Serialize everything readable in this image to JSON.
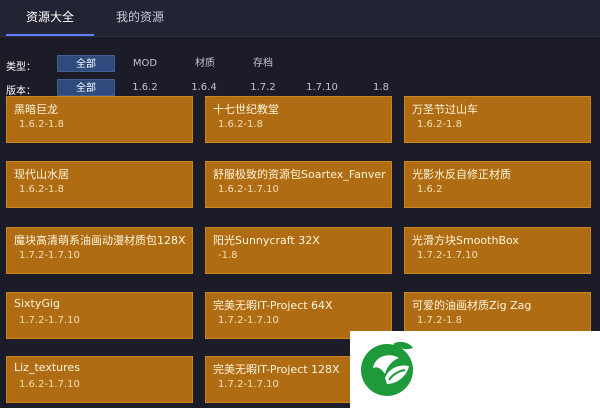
{
  "tabs": [
    {
      "label": "资源大全",
      "active": true
    },
    {
      "label": "我的资源",
      "active": false
    }
  ],
  "filters": {
    "type": {
      "label": "类型：",
      "options": [
        "全部",
        "MOD",
        "材质",
        "存档"
      ],
      "selected": "全部"
    },
    "version": {
      "label": "版本：",
      "options": [
        "全部",
        "1.6.2",
        "1.6.4",
        "1.7.2",
        "1.7.10",
        "1.8"
      ],
      "selected": "全部"
    }
  },
  "resources": [
    {
      "title": "黑暗巨龙",
      "versions": "1.6.2-1.8"
    },
    {
      "title": "十七世纪教堂",
      "versions": "1.6.2-1.8"
    },
    {
      "title": "万圣节过山车",
      "versions": "1.6.2-1.8"
    },
    {
      "title": "现代山水居",
      "versions": "1.6.2-1.8"
    },
    {
      "title": "舒服极致的资源包Soartex_Fanver",
      "versions": "1.6.2-1.7.10"
    },
    {
      "title": "光影水反自修正材质",
      "versions": "1.6.2"
    },
    {
      "title": "魔块高清萌系油画动漫材质包128X",
      "versions": "1.7.2-1.7.10"
    },
    {
      "title": "阳光Sunnycraft 32X",
      "versions": "-1.8"
    },
    {
      "title": "光滑方块SmoothBox",
      "versions": "1.7.2-1.7.10"
    },
    {
      "title": "SixtyGig",
      "versions": "1.7.2-1.7.10"
    },
    {
      "title": "完美无暇IT-Project 64X",
      "versions": "1.7.2-1.7.10"
    },
    {
      "title": "可爱的油画材质Zig Zag",
      "versions": "1.7.2-1.8"
    },
    {
      "title": "Liz_textures",
      "versions": "1.6.2-1.7.10"
    },
    {
      "title": "完美无暇IT-Project 128X",
      "versions": "1.7.2-1.7.10"
    }
  ],
  "colors": {
    "card": "#af6c12",
    "accent": "#5f7dff",
    "logo_green": "#1f9a3a"
  },
  "logo": {
    "icon": "leaf-logo-icon"
  }
}
